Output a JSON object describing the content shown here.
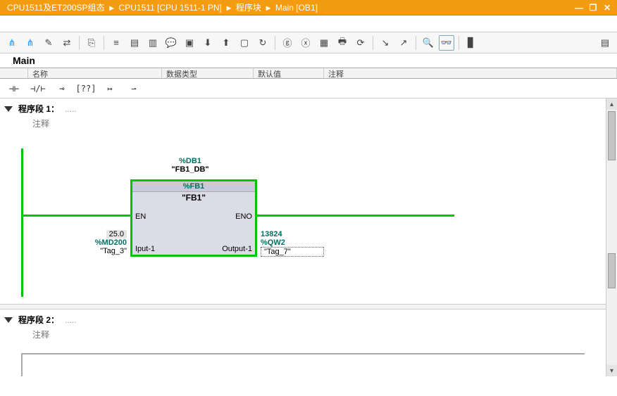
{
  "breadcrumbs": [
    "CPU1511及ET200SP组态",
    "CPU1511 [CPU 1511-1 PN]",
    "程序块",
    "Main [OB1]"
  ],
  "window": {
    "min": "—",
    "restore": "❐",
    "close": "✕"
  },
  "main_label": "Main",
  "col_headers": [
    "",
    "名称",
    "数据类型",
    "默认值",
    "注释"
  ],
  "ladder_ops": [
    "⊣⊢",
    "⊣/⊢",
    "⊸",
    "[??]",
    "↦",
    "⇀"
  ],
  "network1": {
    "title": "程序段 1：",
    "comment": "注释",
    "db_sym": "%DB1",
    "db_name": "\"FB1_DB\"",
    "fb_sym": "%FB1",
    "fb_name": "\"FB1\"",
    "en": "EN",
    "eno": "ENO",
    "input_port": "Iput-1",
    "output_port": "Output-1",
    "in_val": "25.0",
    "in_sym": "%MD200",
    "in_name": "\"Tag_3\"",
    "out_val": "13824",
    "out_sym": "%QW2",
    "out_name": "\"Tag_7\""
  },
  "network2": {
    "title": "程序段 2：",
    "comment": "注释"
  }
}
